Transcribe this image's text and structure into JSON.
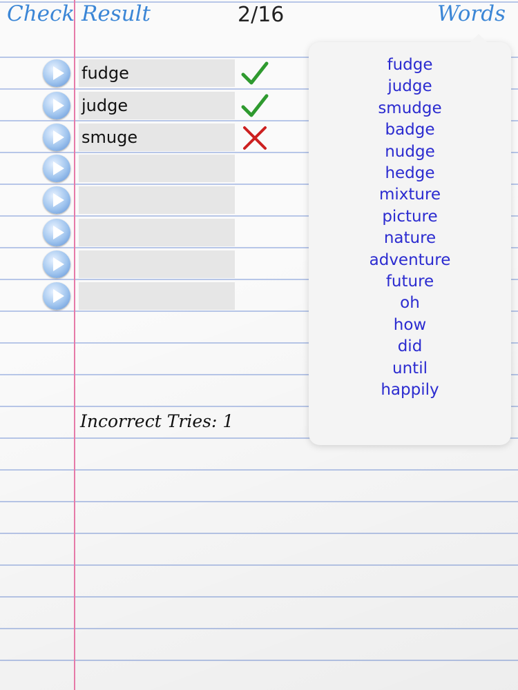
{
  "header": {
    "check_result": "Check Result",
    "counter": "2/16",
    "words_button": "Words"
  },
  "rows": [
    {
      "text": "fudge",
      "result": "correct"
    },
    {
      "text": "judge",
      "result": "correct"
    },
    {
      "text": "smuge",
      "result": "incorrect"
    },
    {
      "text": "",
      "result": ""
    },
    {
      "text": "",
      "result": ""
    },
    {
      "text": "",
      "result": ""
    },
    {
      "text": "",
      "result": ""
    },
    {
      "text": "",
      "result": ""
    }
  ],
  "status": {
    "incorrect_tries": "Incorrect Tries: 1"
  },
  "popover": {
    "words": [
      "fudge",
      "judge",
      "smudge",
      "badge",
      "nudge",
      "hedge",
      "mixture",
      "picture",
      "nature",
      "adventure",
      "future",
      "oh",
      "how",
      "did",
      "until",
      "happily"
    ]
  },
  "icons": {
    "play": "play-circle-icon",
    "correct": "checkmark-icon",
    "incorrect": "cross-icon"
  },
  "colors": {
    "accent": "#3b86d6",
    "word_link": "#2b2bd0",
    "correct": "#2f9a2f",
    "incorrect": "#cc2020",
    "margin_line": "#e67aa8",
    "ruled_line": "#b7c6e8"
  }
}
